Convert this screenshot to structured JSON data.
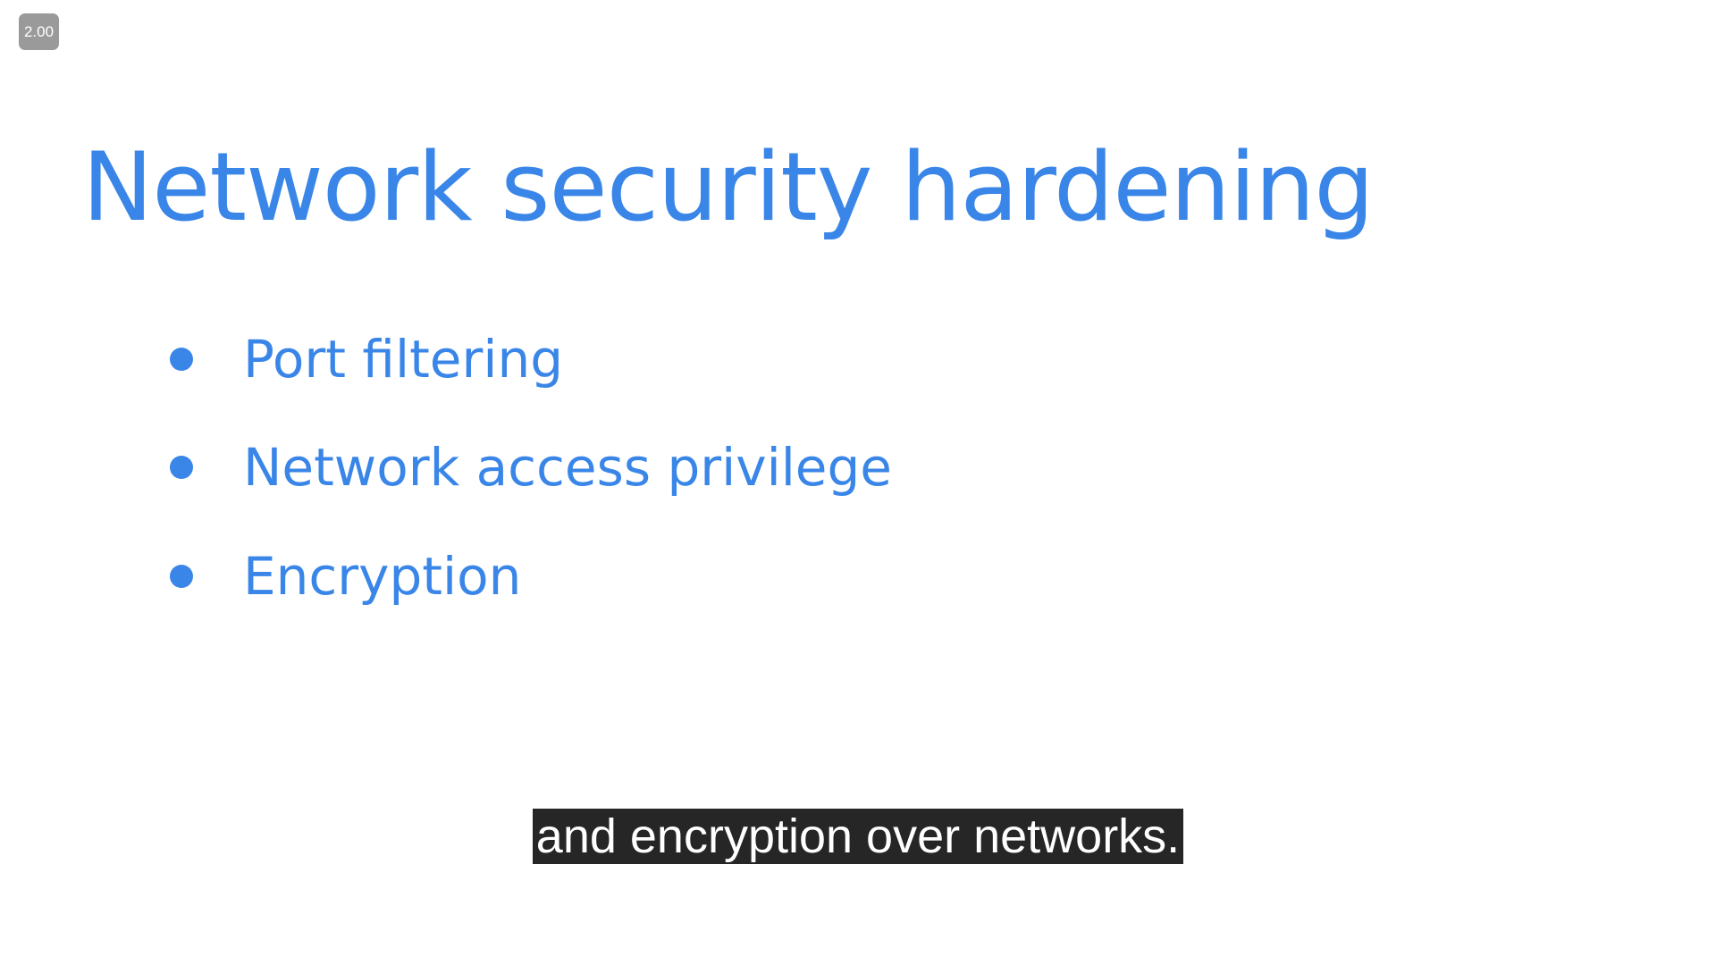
{
  "player": {
    "speed_label": "2.00"
  },
  "slide": {
    "title": "Network security hardening",
    "bullets": [
      "Port filtering",
      "Network access privilege",
      "Encryption"
    ]
  },
  "caption": {
    "text": "and encryption over networks."
  },
  "colors": {
    "accent": "#3a86e8",
    "caption_bg": "#262626",
    "badge_bg": "#9a9a9a"
  }
}
